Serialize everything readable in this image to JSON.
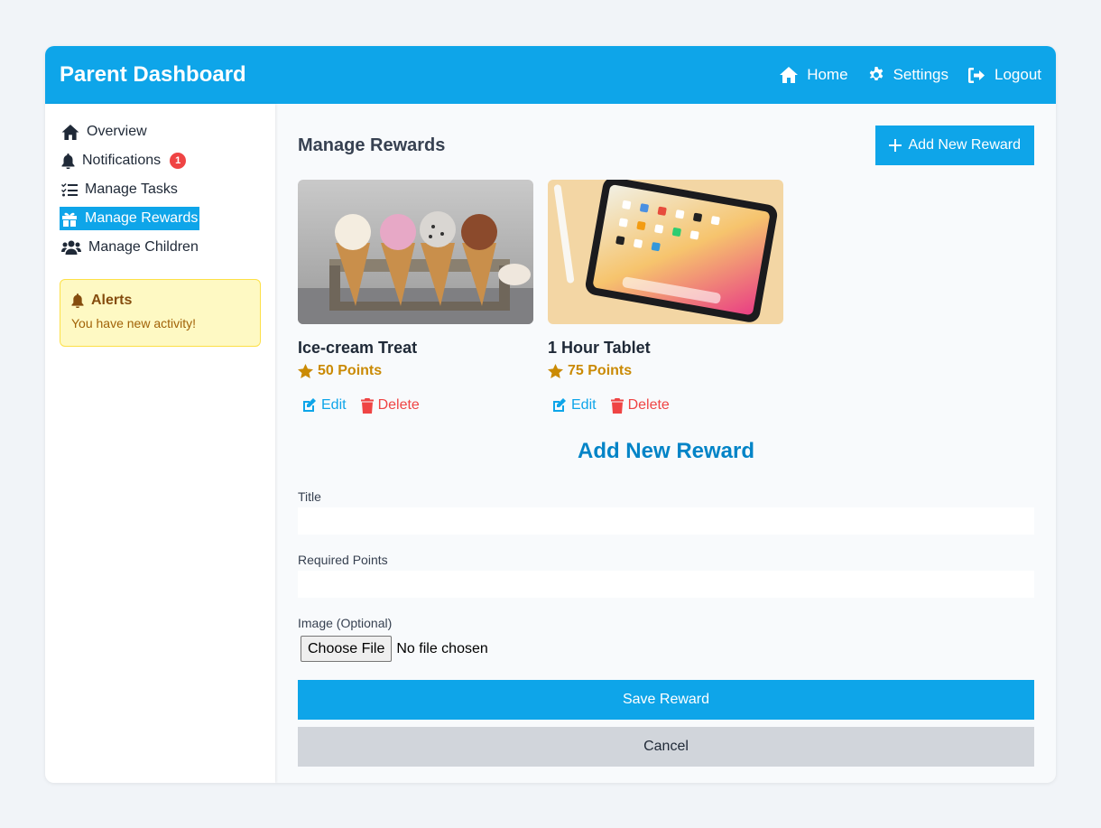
{
  "header": {
    "title": "Parent Dashboard",
    "nav": [
      {
        "label": "Home",
        "icon": "home-icon"
      },
      {
        "label": "Settings",
        "icon": "gear-icon"
      },
      {
        "label": "Logout",
        "icon": "logout-icon"
      }
    ]
  },
  "sidebar": {
    "items": [
      {
        "label": "Overview",
        "icon": "home-icon"
      },
      {
        "label": "Notifications",
        "icon": "bell-icon",
        "badge": "1"
      },
      {
        "label": "Manage Tasks",
        "icon": "tasks-icon"
      },
      {
        "label": "Manage Rewards",
        "icon": "gift-icon",
        "active": true
      },
      {
        "label": "Manage Children",
        "icon": "users-icon"
      }
    ],
    "alert": {
      "title": "Alerts",
      "message": "You have new activity!"
    }
  },
  "main": {
    "title": "Manage Rewards",
    "add_button": "Add New Reward",
    "rewards": [
      {
        "title": "Ice-cream Treat",
        "points": "50 Points",
        "image": "ice-cream-cones-image",
        "edit": "Edit",
        "delete": "Delete"
      },
      {
        "title": "1 Hour Tablet",
        "points": "75 Points",
        "image": "tablet-image",
        "edit": "Edit",
        "delete": "Delete"
      }
    ],
    "form": {
      "heading": "Add New Reward",
      "title_label": "Title",
      "title_value": "",
      "points_label": "Required Points",
      "points_value": "",
      "image_label": "Image (Optional)",
      "file_button": "Choose File",
      "file_status": "No file chosen",
      "save": "Save Reward",
      "cancel": "Cancel"
    }
  },
  "colors": {
    "accent": "#0ea5e9",
    "points": "#ca8a04",
    "danger": "#ef4444",
    "alert_bg": "#fef9c3"
  }
}
